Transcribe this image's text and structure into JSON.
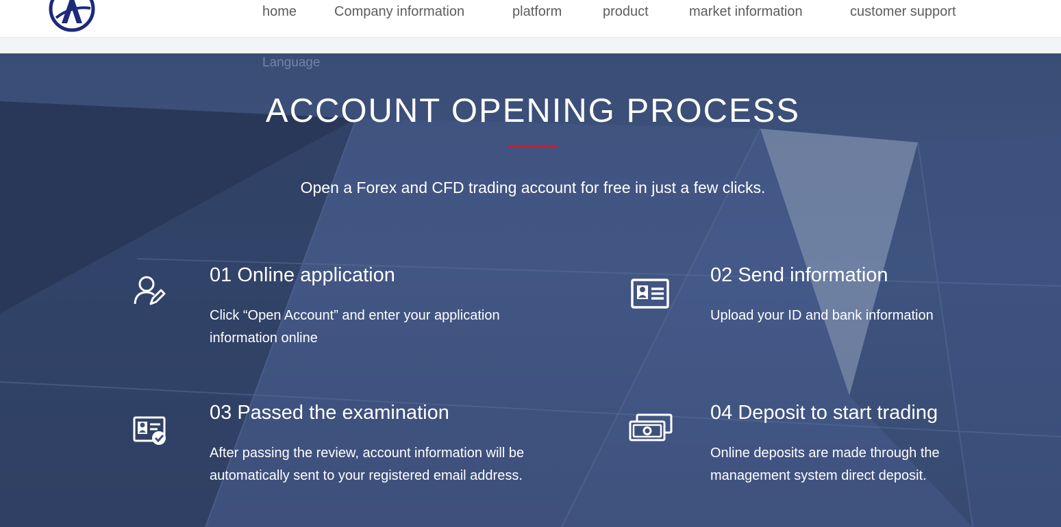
{
  "nav": {
    "items": [
      "home",
      "Company information",
      "platform",
      "product",
      "market information",
      "customer support"
    ],
    "language": "Language"
  },
  "hero": {
    "title": "ACCOUNT OPENING PROCESS",
    "subtitle": "Open a Forex and CFD trading account for free in just a few clicks."
  },
  "steps": [
    {
      "title": "01 Online application",
      "desc": "Click “Open Account” and enter your application information online",
      "icon": "user-edit-icon"
    },
    {
      "title": "02 Send information",
      "desc": "Upload your ID and bank information",
      "icon": "id-card-icon"
    },
    {
      "title": "03 Passed the examination",
      "desc": "After passing the review, account information will be automatically sent to your registered email address.",
      "icon": "verified-id-icon"
    },
    {
      "title": "04 Deposit to start trading",
      "desc": "Online deposits are made through the management system direct deposit.",
      "icon": "banknotes-icon"
    }
  ],
  "colors": {
    "accent": "#c8202c",
    "brand": "#1d2a7a",
    "hero_bg": "#3c5078"
  }
}
